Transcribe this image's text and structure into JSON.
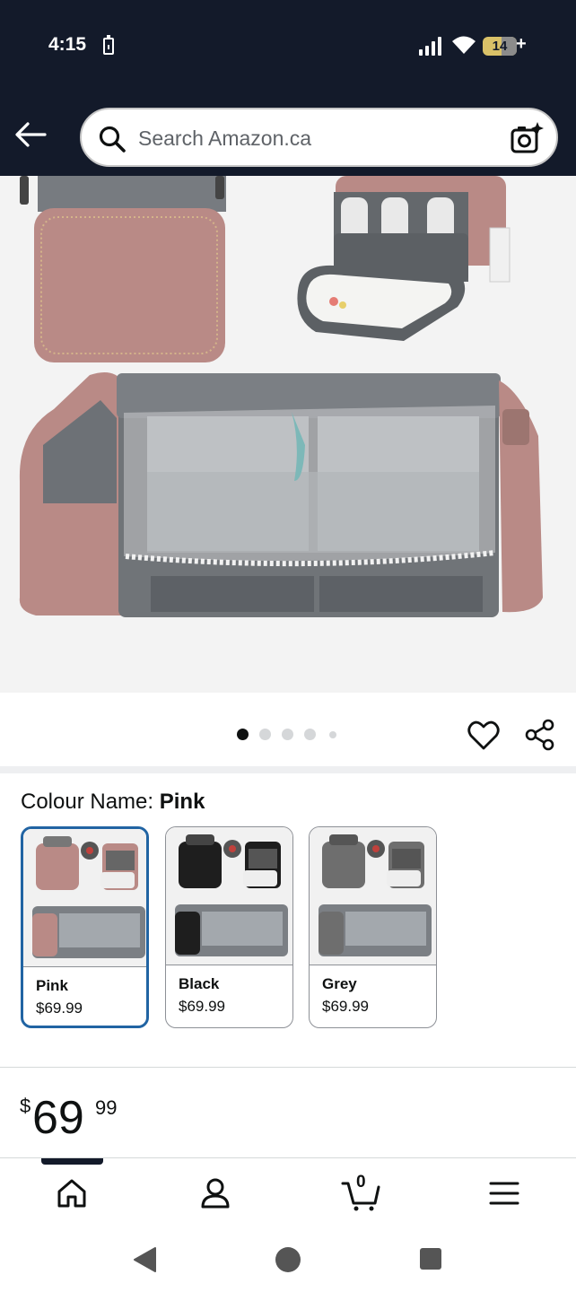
{
  "status_bar": {
    "time": "4:15",
    "battery_level": "14",
    "battery_suffix": "+"
  },
  "header": {
    "search_placeholder": "Search Amazon.ca"
  },
  "product_image": {
    "alt": "Pink diaper bag backpack with foldable bassinet",
    "dot_count": 5,
    "active_dot": 0
  },
  "colour": {
    "label": "Colour Name: ",
    "selected": "Pink"
  },
  "swatches": [
    {
      "name": "Pink",
      "price": "$69.99",
      "color": "#b98a86"
    },
    {
      "name": "Black",
      "price": "$69.99",
      "color": "#1e1e1e"
    },
    {
      "name": "Grey",
      "price": "$69.99",
      "color": "#6e6e6e"
    }
  ],
  "price": {
    "symbol": "$",
    "whole": "69",
    "fraction": "99"
  },
  "bottom_nav": {
    "items": [
      {
        "icon": "home-icon"
      },
      {
        "icon": "account-icon"
      },
      {
        "icon": "cart-icon",
        "count": "0"
      },
      {
        "icon": "menu-icon"
      }
    ]
  },
  "colors": {
    "header_bg": "#131a2a",
    "selected_border": "#2164a3",
    "bag_pink": "#b98a86",
    "bag_grey": "#707478"
  }
}
